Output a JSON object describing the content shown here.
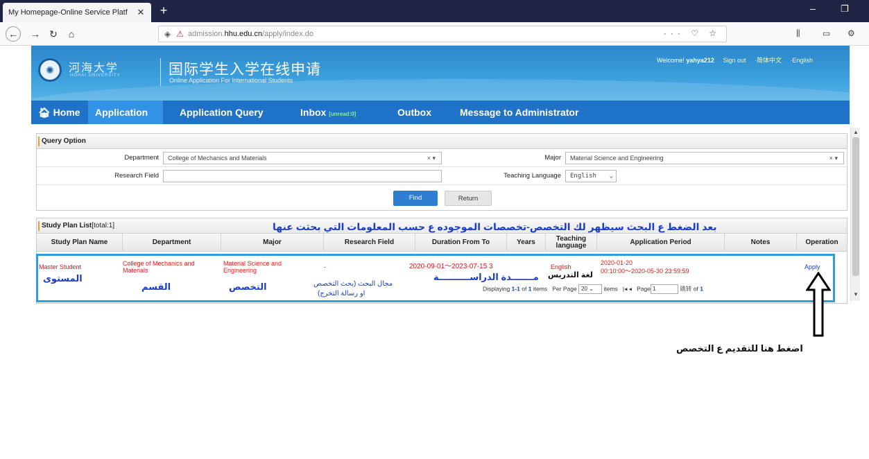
{
  "browser": {
    "tab_title": "My Homepage-Online Service Platf",
    "tab_close": "✕",
    "new_tab": "+",
    "url_prefix": "admission.",
    "url_domain": "hhu.edu.cn",
    "url_path": "/apply/index.do",
    "url_actions": "··· ♡ ☆",
    "min": "–",
    "max": "❐"
  },
  "header": {
    "logo_cn": "河海大学",
    "logo_en": "HOHAI UNIVERSITY",
    "title_cn": "国际学生入学在线申请",
    "title_en": "Online Application For International Students",
    "welcome_prefix": "Welcome!",
    "username": "yahya212",
    "sign_out": "Sign out",
    "lang_cn": "·简体中文",
    "lang_en": "·English"
  },
  "nav": {
    "home": "Home",
    "application": "Application",
    "application_query": "Application Query",
    "inbox": "Inbox",
    "inbox_unread": "[unread:0]",
    "outbox": "Outbox",
    "message_admin": "Message to Administrator"
  },
  "query": {
    "title": "Query Option",
    "department_label": "Department",
    "department_value": "College of Mechanics and Materials",
    "major_label": "Major",
    "major_value": "Material Science and Engineering",
    "research_label": "Research Field",
    "research_value": "",
    "teaching_label": "Teaching Language",
    "teaching_value": "English",
    "clear_dd": "×  ▾",
    "find": "Find",
    "return": "Return"
  },
  "study_list": {
    "title": "Study Plan List",
    "total": "[total:1]",
    "annotation": "بعد الضغط ع البحث سيظهر لك التخصص-تخصصات الموجوده ع  حسب المعلومات التي بحثت عنها",
    "columns": [
      "Study Plan Name",
      "Department",
      "Major",
      "Research Field",
      "Duration From To",
      "Years",
      "Teaching language",
      "Application Period",
      "Notes",
      "Operation"
    ],
    "row": {
      "name": "Master Student",
      "department": "College of Mechanics and Materials",
      "major": "Material Science and Engineering",
      "research": "-",
      "duration": "2020-09-01～2023-07-15",
      "years": "3",
      "language": "English",
      "period_line1": "2020-01-20",
      "period_line2": "00:10:00～2020-05-30 23:59:59",
      "notes": "",
      "operation": "Apply"
    },
    "ar_level": "المستوى",
    "ar_dept": "القسم",
    "ar_major": "التخصص",
    "ar_research_1": "مجال البحث (بحث التخصص",
    "ar_research_2": "او رسالة التخرج)",
    "ar_duration": "مـــــــدة الدراســــــــــة",
    "ar_language": "لغة التدريس",
    "pager": {
      "displaying": "Displaying",
      "range": "1-1",
      "of": "of",
      "count": "1",
      "items": "items",
      "per_page": "Per Page",
      "per_page_value": "20",
      "items2": "items",
      "first": "|◂",
      "prev": "◂",
      "page": "Page",
      "page_value": "1",
      "go": "跳转",
      "of_pages": "of",
      "total_pages": "1"
    }
  },
  "bottom_note": "اضغط هنا للتقديم ع التخصص"
}
